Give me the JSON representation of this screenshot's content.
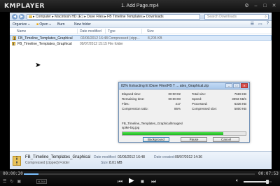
{
  "player": {
    "logo": "KMPLAYER",
    "file_title": "1. Add Page.mp4",
    "window_buttons": [
      "⚙",
      "–",
      "□",
      "✕"
    ],
    "elapsed": "00:00:30",
    "total": "00:07:53",
    "progress": 0.063,
    "volume": 0.85,
    "badge": "H.264",
    "controls": [
      "prev-icon",
      "play-icon",
      "stop-icon",
      "next-icon"
    ]
  },
  "explorer": {
    "address": "▸ Computer ▸ Macintosh HD (E:) ▸ Dave Files ▸ FB Timeline Templates ▸ Downloads",
    "search_placeholder": "Search Downloads",
    "toolbar": {
      "organize": "Organize",
      "open": "Open",
      "burn": "Burn",
      "new_folder": "New folder"
    },
    "columns": [
      "Name",
      "Date modified",
      "Type",
      "Size"
    ],
    "files": [
      {
        "name": "FB_Timeline_Templates_Graphical",
        "date": "02/06/2012 16:48",
        "type": "Compressed (zipp...",
        "size": "8,205 KB"
      },
      {
        "name": "FB_Timeline_Templates_Graphical",
        "date": "09/07/2012 15:15",
        "type": "File folder",
        "size": ""
      }
    ]
  },
  "dialog": {
    "title": "82% Extracting E:\\Dave Files\\FB T ... ates_Graphical.zip",
    "labels": {
      "elapsed": "Elapsed time:",
      "remaining": "Remaining time:",
      "files": "Files:",
      "ratio": "Compression ratio:",
      "total_size": "Total size:",
      "speed": "Speed:",
      "processed": "Processed:",
      "compressed_size": "Compressed size:"
    },
    "values": {
      "elapsed": "00:00:02",
      "remaining": "00:00:00",
      "files": "417",
      "ratio": "86%",
      "total_size": "7669 KB",
      "speed": "3093 KB/s",
      "processed": "6336 KB",
      "compressed_size": "5800 KB"
    },
    "path_line1": "FB_Timeline_Templates_Graphical\\Images\\",
    "path_line2": "spike-big.jpg",
    "progress": 0.82,
    "buttons": {
      "background": "Background",
      "pause": "Pause",
      "cancel": "Cancel"
    }
  },
  "details": {
    "name": "FB_Timeline_Templates_Graphical",
    "type": "Compressed (zipped) Folder",
    "date_modified_label": "Date modified:",
    "date_modified": "02/06/2012 16:48",
    "date_created_label": "Date created:",
    "date_created": "09/07/2012 14:36",
    "size_label": "Size:",
    "size": "8.01 MB"
  }
}
